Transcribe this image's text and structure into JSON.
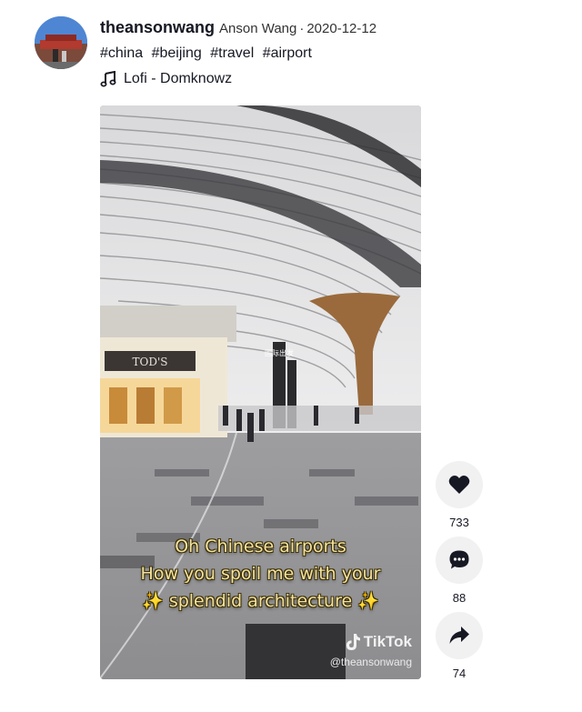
{
  "author": {
    "username": "theansonwang",
    "nickname": "Anson Wang",
    "separator": "·",
    "date": "2020-12-12"
  },
  "description": {
    "hashtags": [
      "#china",
      "#beijing",
      "#travel",
      "#airport"
    ]
  },
  "music": {
    "icon": "music-note-icon",
    "title": "Lofi - Domknowz"
  },
  "video": {
    "caption_lines": [
      "Oh Chinese airports",
      "How you spoil me with your",
      "splendid architecture"
    ],
    "caption_sparkle": "✨",
    "watermark_brand": "TikTok",
    "watermark_handle": "@theansonwang",
    "shop_sign": "TOD'S",
    "wayfinding_sign": "国际出发"
  },
  "actions": [
    {
      "name": "like",
      "icon": "heart-icon",
      "count": "733"
    },
    {
      "name": "comment",
      "icon": "comment-icon",
      "count": "88"
    },
    {
      "name": "share",
      "icon": "share-icon",
      "count": "74"
    }
  ],
  "colors": {
    "text": "#161823",
    "action_bg": "#f1f1f2",
    "caption": "#f3e3a3"
  }
}
